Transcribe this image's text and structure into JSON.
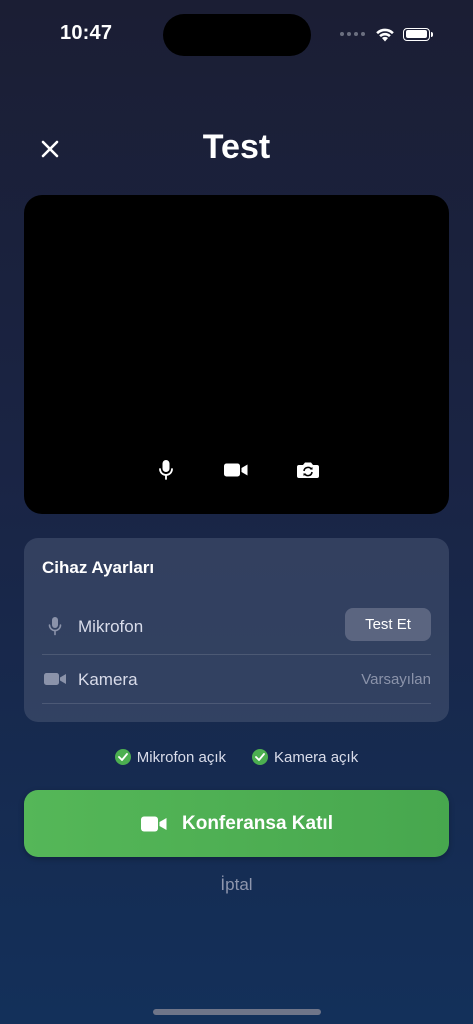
{
  "status_bar": {
    "time": "10:47"
  },
  "header": {
    "title": "Test"
  },
  "device_settings": {
    "title": "Cihaz Ayarları",
    "microphone": {
      "label": "Mikrofon",
      "button_label": "Test Et"
    },
    "camera": {
      "label": "Kamera",
      "value": "Varsayılan"
    }
  },
  "status": {
    "microphone": "Mikrofon açık",
    "camera": "Kamera açık"
  },
  "join_button": {
    "label": "Konferansa Katıl"
  },
  "cancel": {
    "label": "İptal"
  },
  "colors": {
    "accent_green": "#4caf50",
    "card_bg": "#3a4565",
    "background_top": "#1b1e34",
    "background_bottom": "#13305a"
  },
  "icons": [
    "close-icon",
    "microphone-icon",
    "video-camera-icon",
    "camera-switch-icon",
    "check-icon",
    "wifi-icon",
    "battery-icon"
  ]
}
